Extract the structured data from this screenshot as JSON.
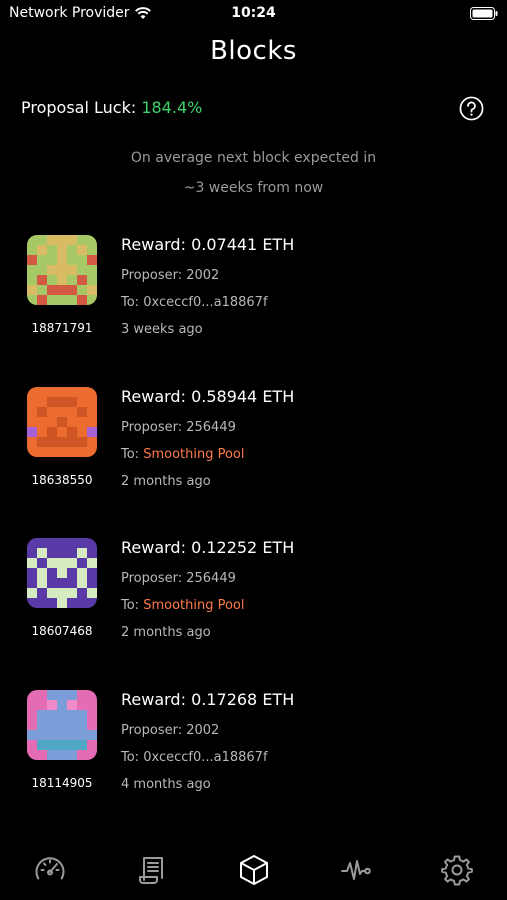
{
  "status_bar": {
    "carrier": "Network Provider",
    "time": "10:24"
  },
  "title": "Blocks",
  "luck": {
    "label": "Proposal Luck: ",
    "value": "184.4%",
    "value_color": "#3ed26a"
  },
  "next_block": {
    "line1": "On average next block expected in",
    "line2": "~3 weeks from now"
  },
  "blocks": [
    {
      "number": "18871791",
      "reward": "Reward: 0.07441 ETH",
      "proposer": "Proposer: 2002",
      "to_prefix": "To: ",
      "to_value": "0xceccf0...a18867f",
      "to_is_pool": false,
      "age": "3 weeks ago"
    },
    {
      "number": "18638550",
      "reward": "Reward: 0.58944 ETH",
      "proposer": "Proposer: 256449",
      "to_prefix": "To: ",
      "to_value": "Smoothing Pool",
      "to_is_pool": true,
      "age": "2 months ago"
    },
    {
      "number": "18607468",
      "reward": "Reward: 0.12252 ETH",
      "proposer": "Proposer: 256449",
      "to_prefix": "To: ",
      "to_value": "Smoothing Pool",
      "to_is_pool": true,
      "age": "2 months ago"
    },
    {
      "number": "18114905",
      "reward": "Reward: 0.17268 ETH",
      "proposer": "Proposer: 2002",
      "to_prefix": "To: ",
      "to_value": "0xceccf0...a18867f",
      "to_is_pool": false,
      "age": "4 months ago"
    }
  ],
  "tabs": [
    {
      "icon": "speedometer-icon"
    },
    {
      "icon": "receipt-icon"
    },
    {
      "icon": "cube-icon",
      "active": true
    },
    {
      "icon": "pulse-icon"
    },
    {
      "icon": "gear-icon"
    }
  ],
  "colors": {
    "background": "#000000",
    "pool_link": "#ff7a4d",
    "muted_text": "#b8b8b8",
    "inactive_tab": "#9a9a9a",
    "active_tab": "#ffffff"
  }
}
